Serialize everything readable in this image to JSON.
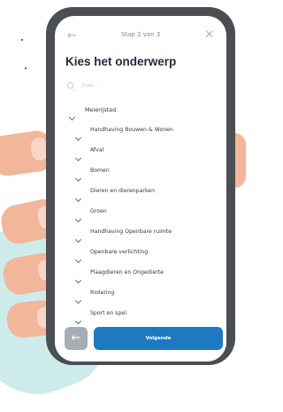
{
  "colors": {
    "phone_frame": "#4b4f53",
    "primary_button": "#1f79c0",
    "secondary_button": "#a7adb5",
    "title_text": "#1c2a3a",
    "skin": "#f2b69a",
    "mint": "#cdebea"
  },
  "icons": {
    "back": "←",
    "close": "✕",
    "back_button": "←"
  },
  "header": {
    "step": "Stap 2 van 3"
  },
  "page": {
    "title": "Kies het onderwerp"
  },
  "search": {
    "placeholder": "Zoek..."
  },
  "list": {
    "group": "Meierijstad",
    "items": [
      "Handhaving Bouwen & Wonen",
      "Afval",
      "Bomen",
      "Dieren en dierenparken",
      "Groen",
      "Handhaving Openbare ruimte",
      "Openbare verlichting",
      "Plaagdieren en Ongedierte",
      "Riolering",
      "Sport en spel"
    ]
  },
  "footer": {
    "next_label": "Volgende"
  }
}
